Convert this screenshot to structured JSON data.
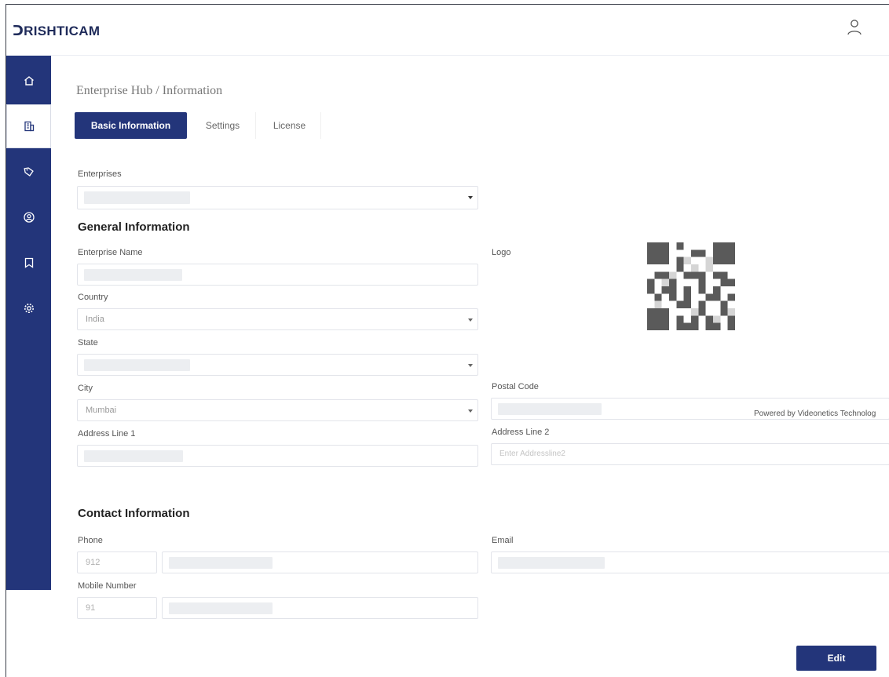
{
  "app": {
    "logo_text": "ᑐRISHTICAM"
  },
  "sidebar": {
    "items": [
      {
        "icon": "home-icon"
      },
      {
        "icon": "building-icon"
      },
      {
        "icon": "tag-icon"
      },
      {
        "icon": "user-circle-icon"
      },
      {
        "icon": "bookmark-icon"
      },
      {
        "icon": "gear-icon"
      }
    ],
    "active_index": 1
  },
  "breadcrumb": "Enterprise Hub / Information",
  "tabs": [
    {
      "label": "Basic Information",
      "active": true
    },
    {
      "label": "Settings",
      "active": false
    },
    {
      "label": "License",
      "active": false
    }
  ],
  "enterprises": {
    "label": "Enterprises",
    "value": ""
  },
  "general": {
    "title": "General Information",
    "enterprise_name_label": "Enterprise Name",
    "logo_label": "Logo",
    "country_label": "Country",
    "country_value": "India",
    "state_label": "State",
    "city_label": "City",
    "city_value": "Mumbai",
    "postal_code_label": "Postal Code",
    "address1_label": "Address Line 1",
    "address2_label": "Address Line 2",
    "address2_placeholder": "Enter Addressline2"
  },
  "powered_by": "Powered by Videonetics Technolog",
  "contact": {
    "title": "Contact Information",
    "phone_label": "Phone",
    "phone_code": "912",
    "email_label": "Email",
    "mobile_label": "Mobile Number",
    "mobile_code": "91"
  },
  "actions": {
    "edit_label": "Edit"
  },
  "colors": {
    "primary": "#23357a",
    "field_border": "#e2e4ea"
  }
}
